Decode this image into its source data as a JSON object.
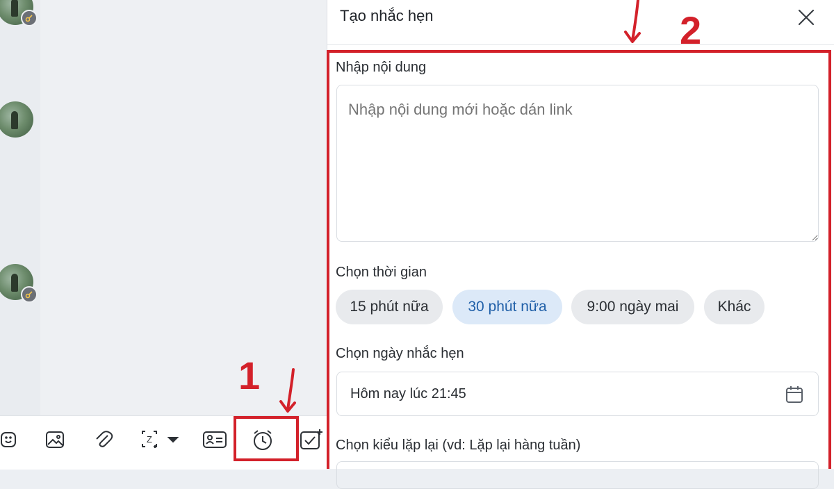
{
  "dialog": {
    "title": "Tạo nhắc hẹn",
    "content_label": "Nhập nội dung",
    "content_placeholder": "Nhập nội dung mới hoặc dán link",
    "content_value": "",
    "time_label": "Chọn thời gian",
    "time_options": [
      {
        "label": "15 phút nữa",
        "selected": false
      },
      {
        "label": "30 phút nữa",
        "selected": true
      },
      {
        "label": "9:00 ngày mai",
        "selected": false
      },
      {
        "label": "Khác",
        "selected": false
      }
    ],
    "date_label": "Chọn ngày nhắc hẹn",
    "date_value": "Hôm nay lúc 21:45",
    "repeat_label": "Chọn kiểu lặp lại (vd: Lặp lại hàng tuần)"
  },
  "toolbar": {
    "icons": [
      "sticker-icon",
      "image-icon",
      "attachment-icon",
      "screenshot-icon",
      "contact-card-icon",
      "alarm-clock-icon",
      "task-icon"
    ]
  },
  "annotations": {
    "step1": "1",
    "step2": "2",
    "color": "#d3212a"
  },
  "colors": {
    "selected_chip_bg": "#dce9f8",
    "selected_chip_text": "#1f5fa8",
    "chip_bg": "#e8eaed"
  }
}
